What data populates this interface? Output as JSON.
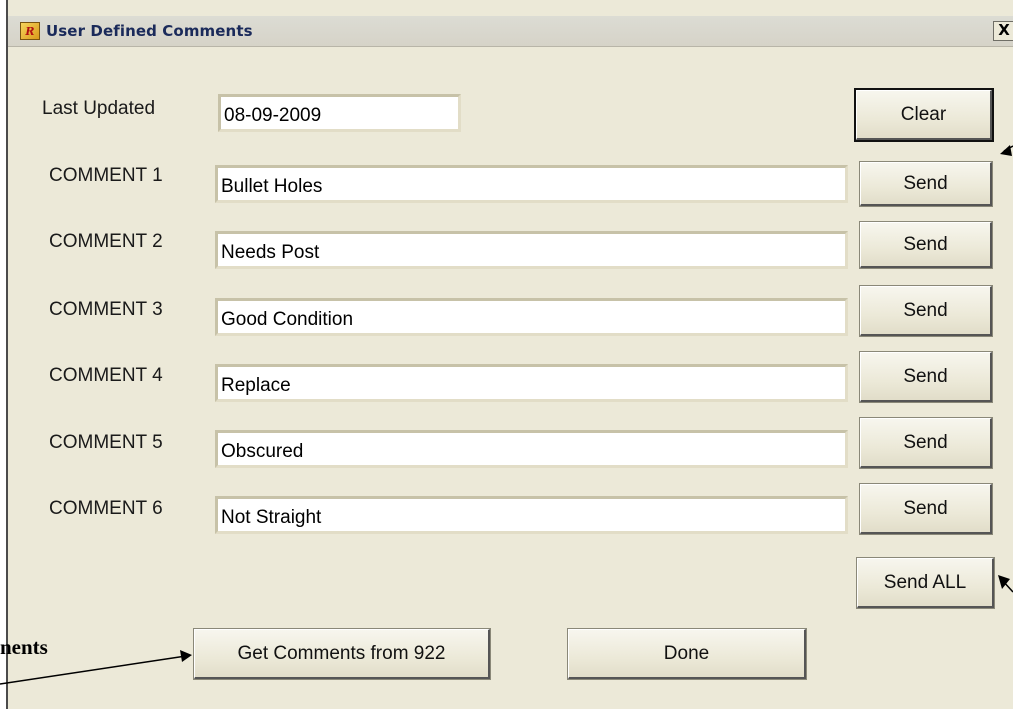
{
  "window": {
    "title": "User Defined Comments",
    "close_label": "X"
  },
  "last_updated": {
    "label": "Last Updated",
    "value": "08-09-2009"
  },
  "clear_label": "Clear",
  "comments": [
    {
      "label": "COMMENT 1",
      "value": "Bullet Holes",
      "send_label": "Send"
    },
    {
      "label": "COMMENT 2",
      "value": "Needs Post",
      "send_label": "Send"
    },
    {
      "label": "COMMENT 3",
      "value": "Good Condition",
      "send_label": "Send"
    },
    {
      "label": "COMMENT 4",
      "value": "Replace",
      "send_label": "Send"
    },
    {
      "label": "COMMENT 5",
      "value": "Obscured",
      "send_label": "Send"
    },
    {
      "label": "COMMENT 6",
      "value": "Not Straight",
      "send_label": "Send"
    }
  ],
  "send_all_label": "Send ALL",
  "get_comments_label": "Get Comments from 922",
  "done_label": "Done",
  "annotation": {
    "text": "nents"
  },
  "icons": [
    "app-icon",
    "close-icon",
    "arrow-icon"
  ]
}
